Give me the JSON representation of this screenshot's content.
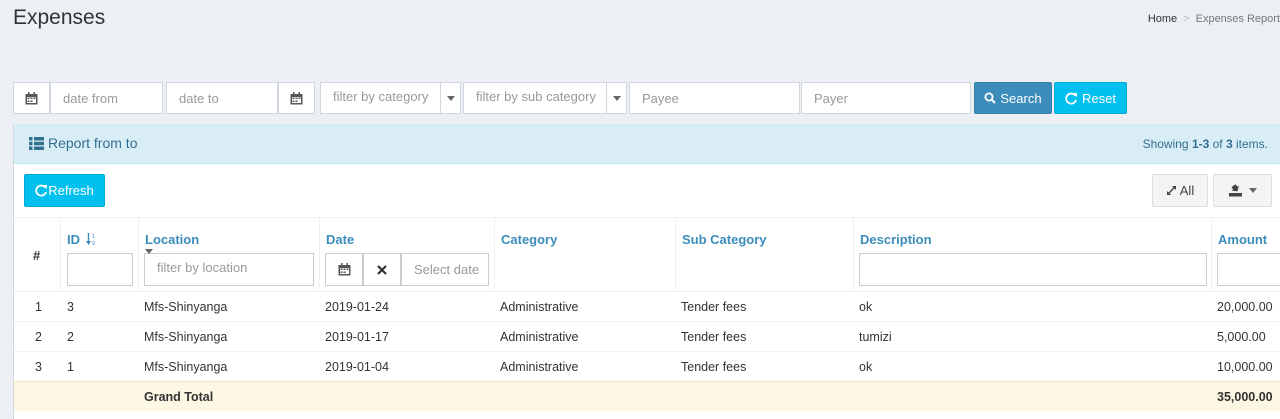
{
  "header": {
    "title": "Expenses",
    "breadcrumb": {
      "home": "Home",
      "separator": ">",
      "current": "Expenses Report"
    }
  },
  "filters": {
    "date_from_placeholder": "date from",
    "date_to_placeholder": "date to",
    "category_placeholder": "filter by category",
    "sub_category_placeholder": "filter by sub category",
    "payee_placeholder": "Payee",
    "payer_placeholder": "Payer",
    "search_label": "Search",
    "reset_label": "Reset"
  },
  "panel": {
    "title": "Report from to",
    "summary_prefix": "Showing ",
    "summary_range": "1-3",
    "summary_mid": " of ",
    "summary_total": "3",
    "summary_suffix": " items.",
    "refresh_label": "Refresh",
    "all_label": "All"
  },
  "table": {
    "columns": {
      "index": "#",
      "id": "ID",
      "location": "Location",
      "date": "Date",
      "category": "Category",
      "sub_category": "Sub Category",
      "description": "Description",
      "amount": "Amount"
    },
    "filter_location_placeholder": "filter by location",
    "filter_date_placeholder": "Select date",
    "rows": [
      {
        "index": "1",
        "id": "3",
        "location": "Mfs-Shinyanga",
        "date": "2019-01-24",
        "category": "Administrative",
        "sub_category": "Tender fees",
        "description": "ok",
        "amount": "20,000.00"
      },
      {
        "index": "2",
        "id": "2",
        "location": "Mfs-Shinyanga",
        "date": "2019-01-17",
        "category": "Administrative",
        "sub_category": "Tender fees",
        "description": "tumizi",
        "amount": "5,000.00"
      },
      {
        "index": "3",
        "id": "1",
        "location": "Mfs-Shinyanga",
        "date": "2019-01-04",
        "category": "Administrative",
        "sub_category": "Tender fees",
        "description": "ok",
        "amount": "10,000.00"
      }
    ],
    "grand_total_label": "Grand Total",
    "grand_total_amount": "35,000.00"
  },
  "icons": {
    "calendar": "calendar-icon",
    "search": "search-icon",
    "refresh": "refresh-icon",
    "list": "list-icon",
    "expand": "expand-icon",
    "export": "export-icon",
    "sort": "sort-icon",
    "clear": "close-icon"
  },
  "colors": {
    "primary": "#3c8dbc",
    "info": "#00c0ef",
    "panel_head": "#d9edf7",
    "total_row": "#fcf8e3"
  }
}
